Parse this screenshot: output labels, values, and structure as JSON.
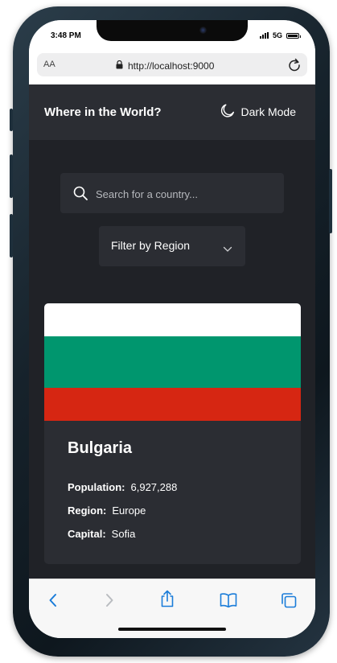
{
  "status_bar": {
    "time": "3:48 PM",
    "network": "5G"
  },
  "browser": {
    "text_size": "AA",
    "url": "http://localhost:9000"
  },
  "header": {
    "title": "Where in the World?",
    "theme_toggle_label": "Dark Mode"
  },
  "search": {
    "placeholder": "Search for a country..."
  },
  "filter": {
    "label": "Filter by Region"
  },
  "country_card": {
    "name": "Bulgaria",
    "population_label": "Population:",
    "population": "6,927,288",
    "region_label": "Region:",
    "region": "Europe",
    "capital_label": "Capital:",
    "capital": "Sofia",
    "flag_colors": [
      "#ffffff",
      "#00966e",
      "#d62612"
    ]
  },
  "colors": {
    "background": "#202227",
    "elements": "#2b2d33",
    "text": "#ffffff",
    "toolbar_accent": "#1a7cd9"
  },
  "toolbar": {
    "icons": [
      "back-icon",
      "forward-icon",
      "share-icon",
      "bookmarks-icon",
      "tabs-icon"
    ]
  }
}
